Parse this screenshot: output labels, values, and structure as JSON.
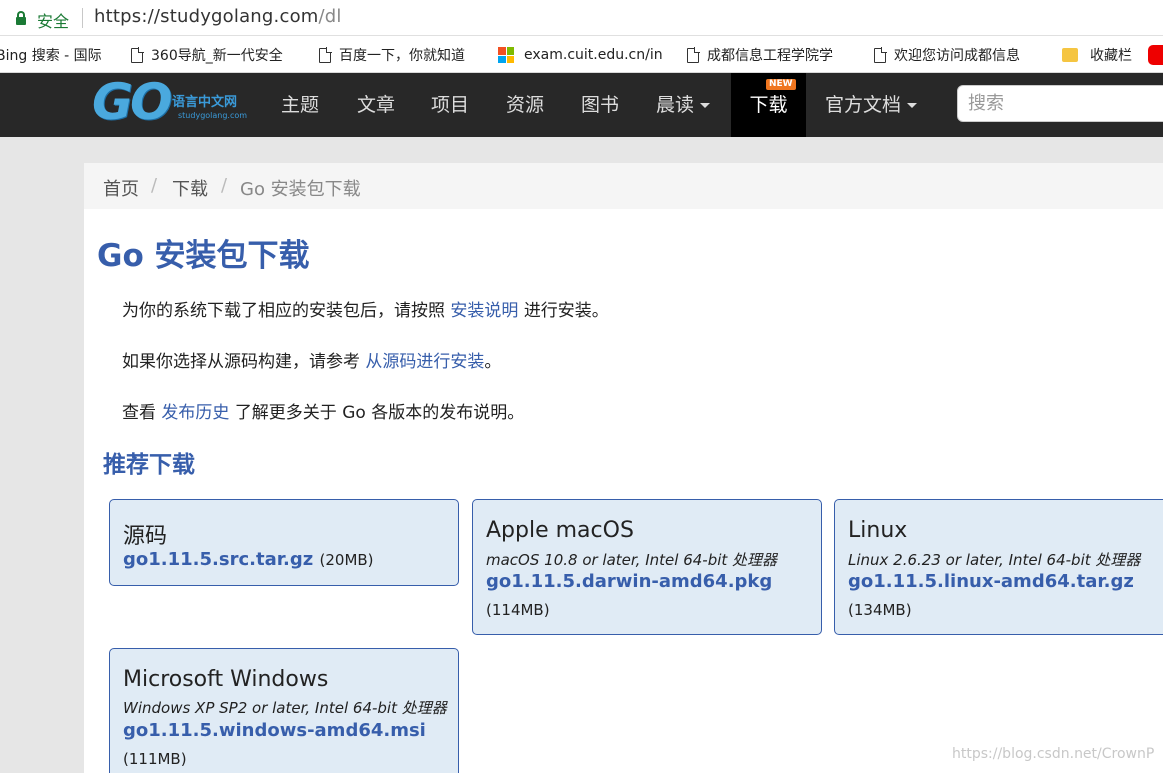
{
  "browser": {
    "secure_label": "安全",
    "url_host": "https://studygolang.com",
    "url_path": "/dl"
  },
  "bookmarks": [
    {
      "label": "Bing 搜索 - 国际",
      "icon": "bing-icon"
    },
    {
      "label": "360导航_新一代安全",
      "icon": "page-icon"
    },
    {
      "label": "百度一下，你就知道",
      "icon": "page-icon"
    },
    {
      "label": "exam.cuit.edu.cn/in",
      "icon": "microsoft-icon"
    },
    {
      "label": "成都信息工程学院学",
      "icon": "page-icon"
    },
    {
      "label": "欢迎您访问成都信息",
      "icon": "page-icon"
    },
    {
      "label": "收藏栏",
      "icon": "folder-icon"
    }
  ],
  "nav": {
    "logo_text": "GO",
    "logo_cn": "语言中文网",
    "logo_domain": "studygolang.com",
    "items": [
      {
        "label": "主题"
      },
      {
        "label": "文章"
      },
      {
        "label": "项目"
      },
      {
        "label": "资源"
      },
      {
        "label": "图书"
      },
      {
        "label": "晨读"
      },
      {
        "label": "下载"
      },
      {
        "label": "官方文档"
      }
    ],
    "new_badge": "NEW",
    "search_placeholder": "搜索"
  },
  "breadcrumb": {
    "home": "首页",
    "sep": "/",
    "download": "下载",
    "current": "Go 安装包下载"
  },
  "content": {
    "title": "Go 安装包下载",
    "p1_pre": "为你的系统下载了相应的安装包后，请按照",
    "p1_link": "安装说明",
    "p1_post": "进行安装。",
    "p2_pre": "如果你选择从源码构建，请参考",
    "p2_link": "从源码进行安装",
    "p2_post": "。",
    "p3_pre": "查看",
    "p3_link": "发布历史",
    "p3_post": "了解更多关于 Go 各版本的发布说明。",
    "recommended": "推荐下载"
  },
  "downloads": [
    {
      "os": "源码",
      "requirement": "",
      "file": "go1.11.5.src.tar.gz",
      "size": "(20MB)"
    },
    {
      "os": "Apple macOS",
      "requirement": "macOS 10.8 or later, Intel 64-bit 处理器",
      "file": "go1.11.5.darwin-amd64.pkg",
      "size": "(114MB)"
    },
    {
      "os": "Linux",
      "requirement": "Linux 2.6.23 or later, Intel 64-bit 处理器",
      "file": "go1.11.5.linux-amd64.tar.gz",
      "size": "(134MB)"
    },
    {
      "os": "Microsoft Windows",
      "requirement": "Windows XP SP2 or later, Intel 64-bit 处理器",
      "file": "go1.11.5.windows-amd64.msi",
      "size": "(111MB)"
    }
  ],
  "watermark": "https://blog.csdn.net/CrownP",
  "colors": {
    "link": "#375eab",
    "nav_bg": "#282828",
    "card_bg": "#e0ebf5",
    "secure": "#1b7a35"
  }
}
